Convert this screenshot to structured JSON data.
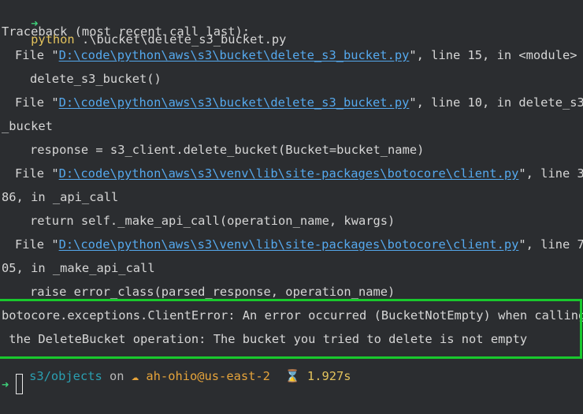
{
  "terminal": {
    "prompt_arrow": "➜",
    "command_keyword": "python",
    "command_arg": " .\\bucket\\delete_s3_bucket.py",
    "traceback_header": "Traceback (most recent call last):",
    "frames": [
      {
        "prefix": "File \"",
        "path": "D:\\code\\python\\aws\\s3\\bucket\\delete_s3_bucket.py",
        "suffix": "\", line 15, in <module>",
        "wrap": "",
        "code": "delete_s3_bucket()"
      },
      {
        "prefix": "File \"",
        "path": "D:\\code\\python\\aws\\s3\\bucket\\delete_s3_bucket.py",
        "suffix": "\", line 10, in delete_s3",
        "wrap": "_bucket",
        "code": "response = s3_client.delete_bucket(Bucket=bucket_name)"
      },
      {
        "prefix": "File \"",
        "path": "D:\\code\\python\\aws\\s3\\venv\\lib\\site-packages\\botocore\\client.py",
        "suffix": "\", line 3",
        "wrap": "86, in _api_call",
        "code": "return self._make_api_call(operation_name, kwargs)"
      },
      {
        "prefix": "File \"",
        "path": "D:\\code\\python\\aws\\s3\\venv\\lib\\site-packages\\botocore\\client.py",
        "suffix": "\", line 7",
        "wrap": "05, in _make_api_call",
        "code": "raise error_class(parsed_response, operation_name)"
      }
    ],
    "error_line_1": "botocore.exceptions.ClientError: An error occurred (BucketNotEmpty) when calling",
    "error_line_2": " the DeleteBucket operation: The bucket you tried to delete is not empty",
    "status": {
      "dir": "s3/objects",
      "on": " on ",
      "aws_icon": "cloud-icon",
      "profile": "ah-ohio@us-east-2",
      "hourglass_icon": "hourglass-icon",
      "duration": "1.927s"
    },
    "next_prompt_arrow": "➜"
  },
  "colors": {
    "background": "#2b2d30",
    "text": "#d6d6d6",
    "link": "#55a9ee",
    "highlight_border": "#19c82d",
    "prompt": "#3fd07a",
    "keyword": "#e2c25c"
  }
}
